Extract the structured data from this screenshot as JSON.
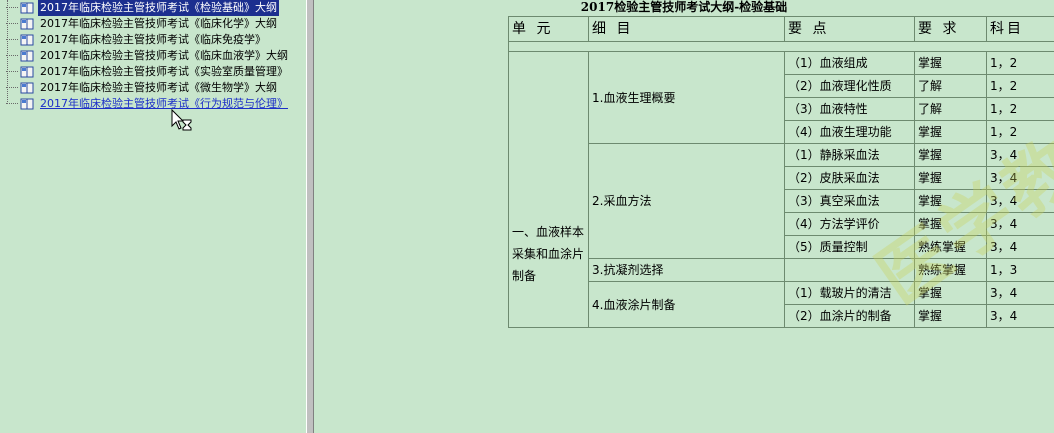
{
  "tree": {
    "items": [
      {
        "label": "2017年临床检验主管技师考试《检验基础》大纲",
        "state": "selected"
      },
      {
        "label": "2017年临床检验主管技师考试《临床化学》大纲",
        "state": "normal"
      },
      {
        "label": "2017年临床检验主管技师考试《临床免疫学》",
        "state": "normal"
      },
      {
        "label": "2017年临床检验主管技师考试《临床血液学》大纲",
        "state": "normal"
      },
      {
        "label": "2017年临床检验主管技师考试《实验室质量管理》",
        "state": "normal"
      },
      {
        "label": "2017年临床检验主管技师考试《微生物学》大纲",
        "state": "normal"
      },
      {
        "label": "2017年临床检验主管技师考试《行为规范与伦理》",
        "state": "hover"
      }
    ]
  },
  "document": {
    "title": "2017检验主管技师考试大纲-检验基础",
    "headers": [
      "单 元",
      "细 目",
      "要 点",
      "要 求",
      "科目"
    ],
    "unit": "一、血液样本采集和血涂片制备",
    "subitems": {
      "s1": "1.血液生理概要",
      "s2": "2.采血方法",
      "s3": "3.抗凝剂选择",
      "s4": "4.血液涂片制备"
    },
    "rows": [
      {
        "point": "（1）血液组成",
        "req": "掌握",
        "subject": "1，2"
      },
      {
        "point": "（2）血液理化性质",
        "req": "了解",
        "subject": "1，2"
      },
      {
        "point": "（3）血液特性",
        "req": "了解",
        "subject": "1，2"
      },
      {
        "point": "（4）血液生理功能",
        "req": "掌握",
        "subject": "1，2"
      },
      {
        "point": "（1）静脉采血法",
        "req": "掌握",
        "subject": "3，4"
      },
      {
        "point": "（2）皮肤采血法",
        "req": "掌握",
        "subject": "3，4"
      },
      {
        "point": "（3）真空采血法",
        "req": "掌握",
        "subject": "3，4"
      },
      {
        "point": "（4）方法学评价",
        "req": "掌握",
        "subject": "3，4"
      },
      {
        "point": "（5）质量控制",
        "req": "熟练掌握",
        "subject": "3，4"
      },
      {
        "point": "",
        "req": "熟练掌握",
        "subject": "1，3"
      },
      {
        "point": "（1）载玻片的清洁",
        "req": "掌握",
        "subject": "3，4"
      },
      {
        "point": "（2）血涂片的制备",
        "req": "掌握",
        "subject": "3，4"
      }
    ],
    "watermark": "医学教育网"
  },
  "icons": {
    "tree_item": "book-icon",
    "cursor": "busy-arrow-cursor-icon"
  },
  "colors": {
    "background": "#c8e6cc",
    "selection": "#1c2f8f",
    "link": "#1c2fc8"
  }
}
